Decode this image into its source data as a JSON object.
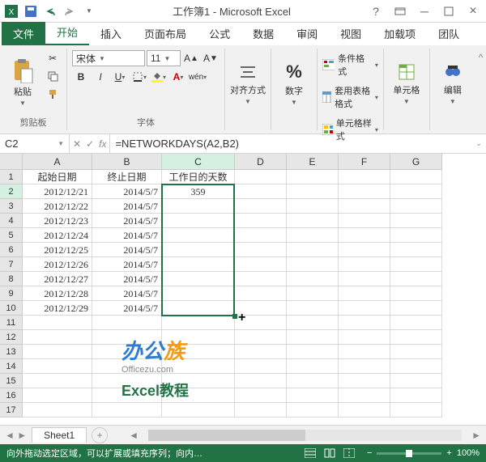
{
  "title": "工作簿1 - Microsoft Excel",
  "tabs": {
    "file": "文件",
    "home": "开始",
    "insert": "插入",
    "layout": "页面布局",
    "formulas": "公式",
    "data": "数据",
    "review": "审阅",
    "view": "视图",
    "addins": "加载项",
    "team": "团队"
  },
  "ribbon": {
    "clipboard": {
      "paste": "粘贴",
      "label": "剪贴板"
    },
    "font": {
      "name": "宋体",
      "size": "11",
      "label": "字体"
    },
    "align": {
      "label": "对齐方式"
    },
    "number": {
      "label": "数字"
    },
    "styles": {
      "cond": "条件格式",
      "table": "套用表格格式",
      "cell": "单元格样式"
    },
    "cells": {
      "label": "单元格"
    },
    "editing": {
      "label": "编辑"
    }
  },
  "namebox": "C2",
  "formula": "=NETWORKDAYS(A2,B2)",
  "columns": [
    "A",
    "B",
    "C",
    "D",
    "E",
    "F",
    "G"
  ],
  "headers": {
    "a": "起始日期",
    "b": "终止日期",
    "c": "工作日的天数"
  },
  "data_rows": [
    {
      "a": "2012/12/21",
      "b": "2014/5/7",
      "c": "359"
    },
    {
      "a": "2012/12/22",
      "b": "2014/5/7",
      "c": ""
    },
    {
      "a": "2012/12/23",
      "b": "2014/5/7",
      "c": ""
    },
    {
      "a": "2012/12/24",
      "b": "2014/5/7",
      "c": ""
    },
    {
      "a": "2012/12/25",
      "b": "2014/5/7",
      "c": ""
    },
    {
      "a": "2012/12/26",
      "b": "2014/5/7",
      "c": ""
    },
    {
      "a": "2012/12/27",
      "b": "2014/5/7",
      "c": ""
    },
    {
      "a": "2012/12/28",
      "b": "2014/5/7",
      "c": ""
    },
    {
      "a": "2012/12/29",
      "b": "2014/5/7",
      "c": ""
    }
  ],
  "watermark": {
    "brand1": "办公",
    "brand2": "族",
    "url": "Officezu.com",
    "sub": "Excel教程"
  },
  "sheet": "Sheet1",
  "status": "向外拖动选定区域，可以扩展或填充序列；向内…",
  "zoom": "100%"
}
